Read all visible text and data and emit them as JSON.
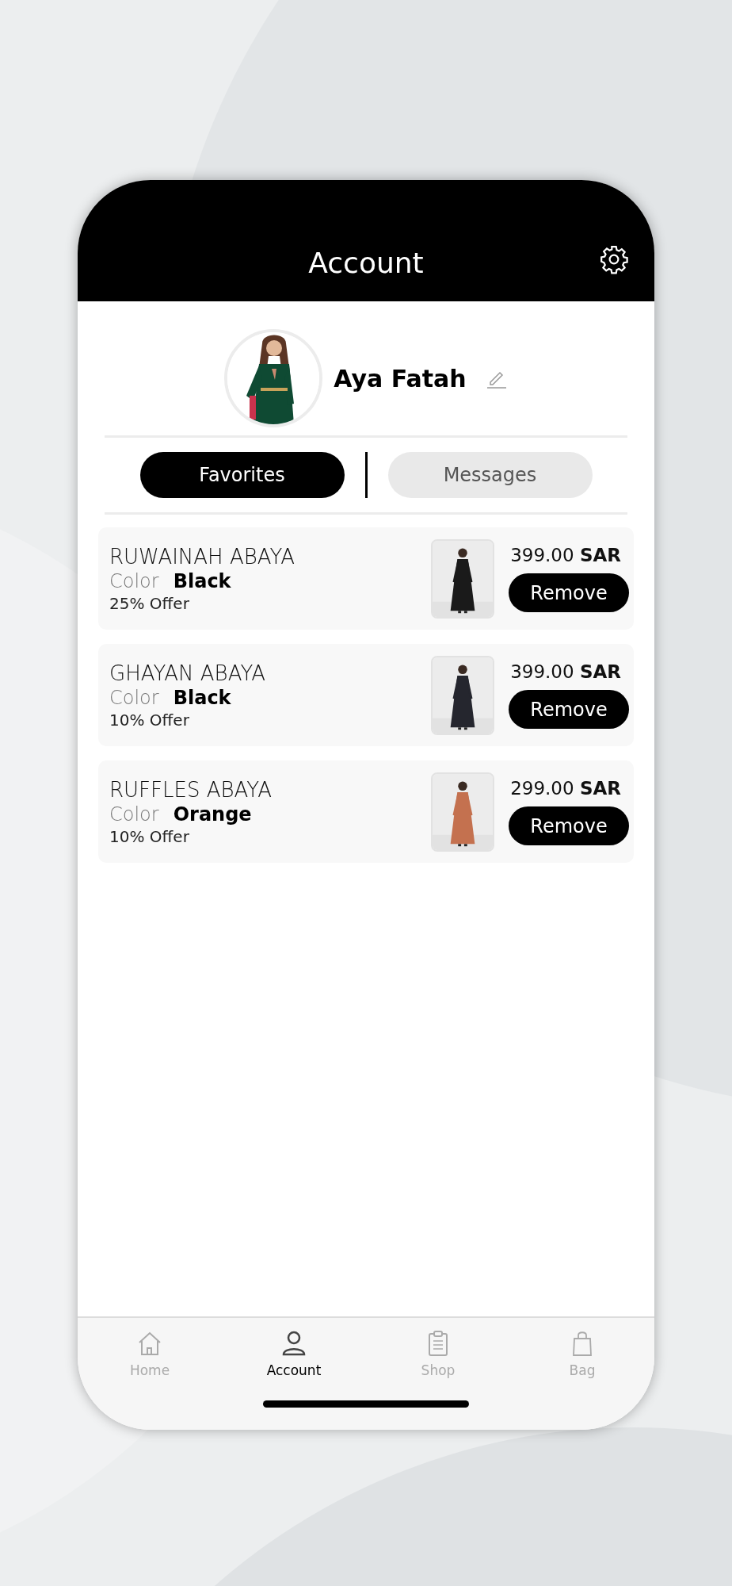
{
  "header": {
    "title": "Account"
  },
  "profile": {
    "name": "Aya Fatah"
  },
  "tabs": [
    {
      "label": "Favorites",
      "selected": true
    },
    {
      "label": "Messages",
      "selected": false
    }
  ],
  "favorites": [
    {
      "name": "RUWAINAH ABAYA",
      "color_label": "Color",
      "color_name": "Black",
      "offer": "25% Offer",
      "price": "399.00 **SAR**",
      "button": "Remove"
    },
    {
      "name": "GHAYAN ABAYA",
      "color_label": "Color",
      "color_name": "Black",
      "offer": "10% Offer",
      "price": "399.00 **SAR**",
      "button": "Remove"
    },
    {
      "name": "RUFFLES ABAYA",
      "color_label": "Color",
      "color_name": "Orange",
      "offer": "10% Offer",
      "price": "299.00 **SAR**",
      "button": "Remove"
    }
  ],
  "tab_bar": [
    {
      "label": "Home",
      "kind": "home",
      "selected": false
    },
    {
      "label": "Account",
      "kind": "account",
      "selected": true
    },
    {
      "label": "Shop",
      "kind": "shop",
      "selected": false
    },
    {
      "label": "Bag",
      "kind": "bag",
      "selected": false
    }
  ]
}
